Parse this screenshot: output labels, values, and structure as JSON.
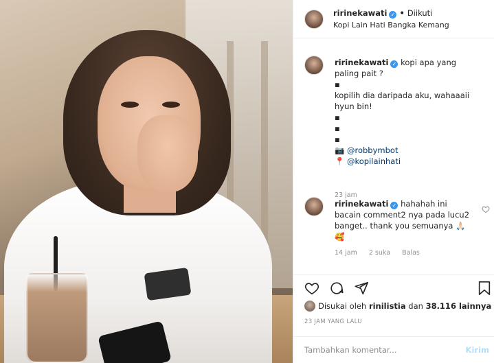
{
  "post": {
    "username": "ririnekawati",
    "following_label": "Diikuti",
    "location": "Kopi Lain Hati Bangka Kemang"
  },
  "caption": {
    "username": "ririnekawati",
    "line1": "kopi apa yang paling pait ?",
    "dot1": "▪",
    "line2": "kopilih dia daripada aku, wahaaaii hyun bin!",
    "dot2": "▪",
    "dot3": "▪",
    "dot4": "▪",
    "tag1_emoji": "📷",
    "tag1": "@robbymbot",
    "tag2_emoji": "📍",
    "tag2": "@kopilainhati",
    "time": "23 jam"
  },
  "reply": {
    "username": "ririnekawati",
    "text": "hahahah ini bacain comment2 nya pada lucu2 banget.. thank you semuanya 🙏🏻🥰",
    "time": "14 jam",
    "likes": "2 suka",
    "reply_label": "Balas"
  },
  "likes": {
    "prefix": "Disukai oleh",
    "user": "rinilistia",
    "connector": "dan",
    "count": "38.116 lainnya"
  },
  "timestamp": "23 JAM YANG LALU",
  "comment_box": {
    "placeholder": "Tambahkan komentar...",
    "post_label": "Kirim"
  },
  "colors": {
    "verified": "#3897f0",
    "link": "#00376b",
    "muted": "#8e8e8e",
    "post_disabled": "#b2dffc"
  },
  "icons": [
    "heart-icon",
    "comment-icon",
    "share-icon",
    "bookmark-icon",
    "verified-icon",
    "small-heart-icon"
  ]
}
